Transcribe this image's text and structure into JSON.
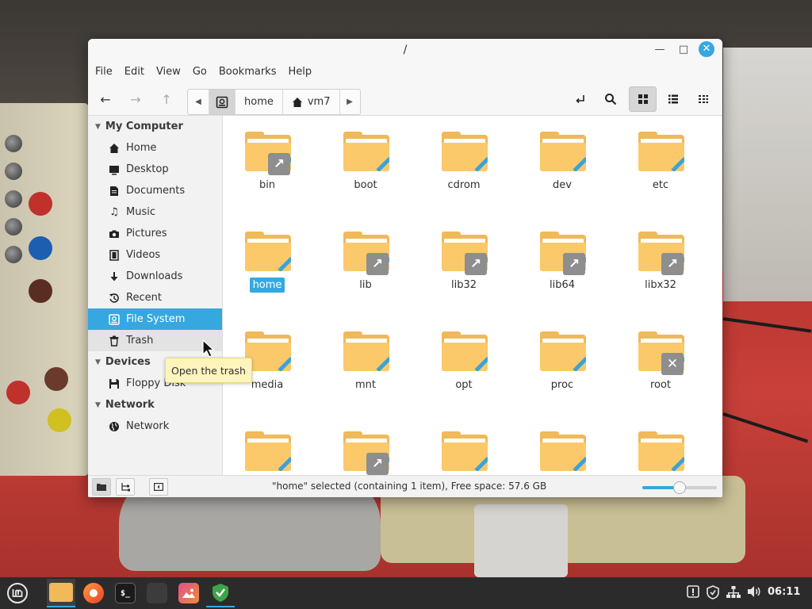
{
  "window": {
    "title": "/",
    "minimize_label": "—",
    "maximize_label": "□",
    "close_label": "✕"
  },
  "menubar": {
    "items": [
      "File",
      "Edit",
      "View",
      "Go",
      "Bookmarks",
      "Help"
    ]
  },
  "toolbar": {
    "path_segments": [
      "home",
      "vm7"
    ]
  },
  "sidebar": {
    "sections": [
      {
        "title": "My Computer",
        "items": [
          {
            "label": "Home",
            "icon": "home-icon"
          },
          {
            "label": "Desktop",
            "icon": "desktop-icon"
          },
          {
            "label": "Documents",
            "icon": "documents-icon"
          },
          {
            "label": "Music",
            "icon": "music-icon"
          },
          {
            "label": "Pictures",
            "icon": "camera-icon"
          },
          {
            "label": "Videos",
            "icon": "film-icon"
          },
          {
            "label": "Downloads",
            "icon": "download-icon"
          },
          {
            "label": "Recent",
            "icon": "recent-icon"
          },
          {
            "label": "File System",
            "icon": "drive-icon",
            "selected": true
          },
          {
            "label": "Trash",
            "icon": "trash-icon",
            "hover": true
          }
        ]
      },
      {
        "title": "Devices",
        "items": [
          {
            "label": "Floppy Disk",
            "icon": "floppy-icon"
          }
        ]
      },
      {
        "title": "Network",
        "items": [
          {
            "label": "Network",
            "icon": "globe-icon"
          }
        ]
      }
    ]
  },
  "files": [
    {
      "name": "bin",
      "badge": "link"
    },
    {
      "name": "boot",
      "badge": null
    },
    {
      "name": "cdrom",
      "badge": null
    },
    {
      "name": "dev",
      "badge": null
    },
    {
      "name": "etc",
      "badge": null
    },
    {
      "name": "home",
      "badge": null,
      "selected": true
    },
    {
      "name": "lib",
      "badge": "link"
    },
    {
      "name": "lib32",
      "badge": "link"
    },
    {
      "name": "lib64",
      "badge": "link"
    },
    {
      "name": "libx32",
      "badge": "link"
    },
    {
      "name": "media",
      "badge": null
    },
    {
      "name": "mnt",
      "badge": null
    },
    {
      "name": "opt",
      "badge": null
    },
    {
      "name": "proc",
      "badge": null
    },
    {
      "name": "root",
      "badge": "locked"
    },
    {
      "name": "",
      "badge": null
    },
    {
      "name": "",
      "badge": "link"
    },
    {
      "name": "",
      "badge": null
    },
    {
      "name": "",
      "badge": null
    },
    {
      "name": "",
      "badge": null
    }
  ],
  "statusbar": {
    "text": "\"home\" selected (containing 1 item), Free space: 57.6 GB",
    "zoom_fraction": 0.5
  },
  "tooltip": {
    "text": "Open the trash"
  },
  "panel": {
    "clock": "06:11",
    "apps": [
      "menu-icon",
      "files-icon",
      "firefox-icon",
      "terminal-icon",
      "calculator-icon",
      "image-viewer-icon",
      "shield-app-icon"
    ]
  },
  "colors": {
    "accent": "#35a8e0",
    "folder": "#fbc96a",
    "folder_back": "#f0b959",
    "badge": "#8e8e8e"
  }
}
